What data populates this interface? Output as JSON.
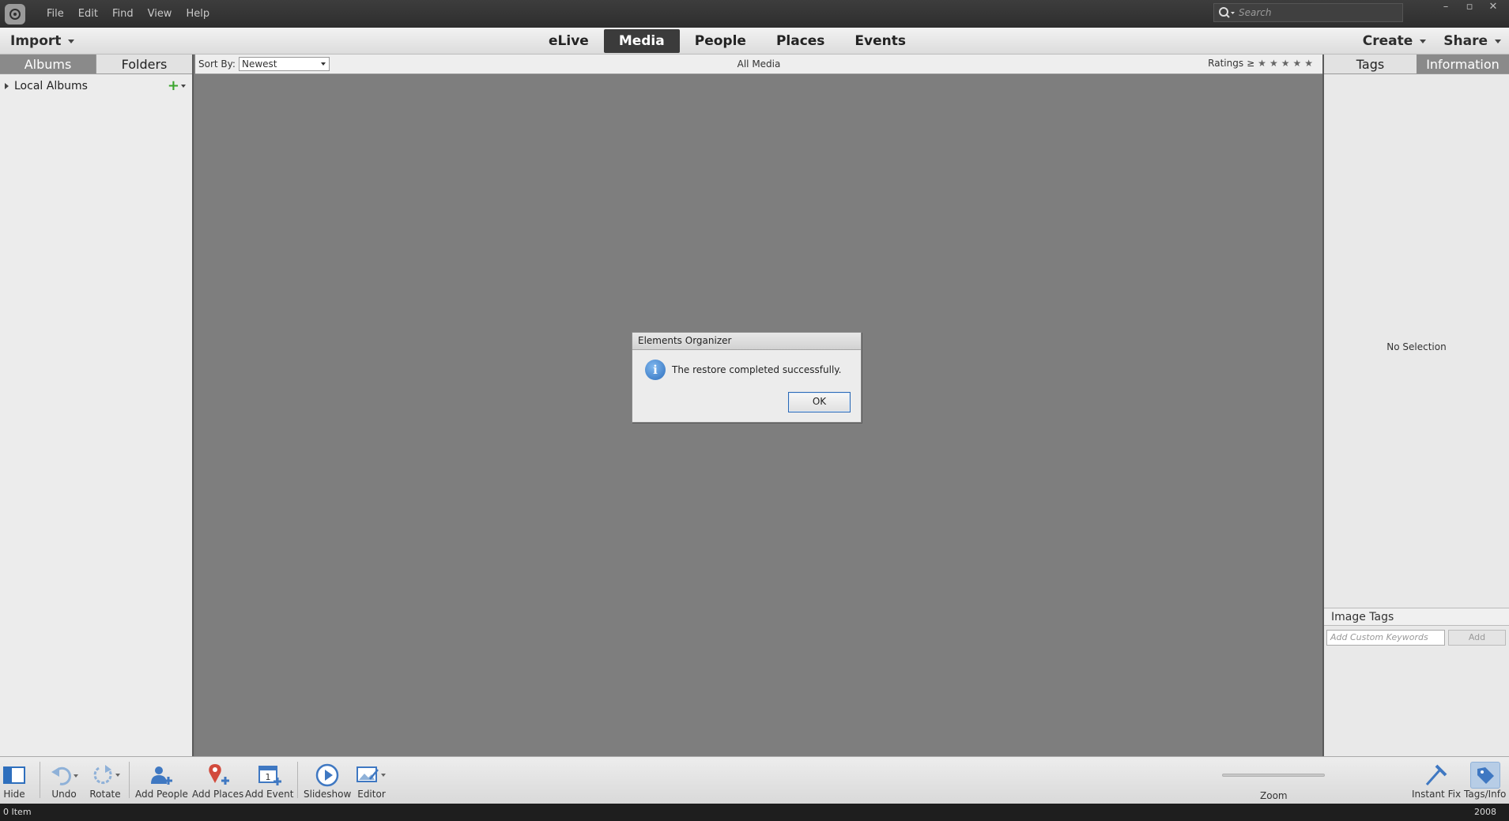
{
  "menu": [
    "File",
    "Edit",
    "Find",
    "View",
    "Help"
  ],
  "search": {
    "placeholder": "Search"
  },
  "window_controls": [
    "–",
    "▫",
    "✕"
  ],
  "nav": {
    "import_label": "Import",
    "tabs": [
      "eLive",
      "Media",
      "People",
      "Places",
      "Events"
    ],
    "active_tab": "Media",
    "create_label": "Create",
    "share_label": "Share"
  },
  "left": {
    "tabs": [
      "Albums",
      "Folders"
    ],
    "active_tab": "Albums",
    "local_albums": "Local Albums"
  },
  "content_header": {
    "sort_by_label": "Sort By:",
    "sort_value": "Newest",
    "view_title": "All Media",
    "ratings_label": "Ratings",
    "ratings_op": "≥"
  },
  "right": {
    "tabs": [
      "Tags",
      "Information"
    ],
    "active_tab": "Information",
    "no_selection": "No Selection",
    "image_tags_label": "Image Tags",
    "keywords_placeholder": "Add Custom Keywords",
    "add_label": "Add"
  },
  "toolbar": {
    "hide": "Hide",
    "undo": "Undo",
    "rotate": "Rotate",
    "add_people": "Add People",
    "add_places": "Add Places",
    "add_event": "Add Event",
    "slideshow": "Slideshow",
    "editor": "Editor",
    "zoom": "Zoom",
    "instant_fix": "Instant Fix",
    "tags_info": "Tags/Info"
  },
  "status": {
    "count": "0 Item",
    "year": "2008"
  },
  "dialog": {
    "title": "Elements Organizer",
    "message": "The restore completed successfully.",
    "ok_label": "OK"
  },
  "colors": {
    "accent_blue": "#2e6fbd",
    "active_tab_bg": "#3b3b3b",
    "panel_tab_active": "#8a8a8a"
  }
}
